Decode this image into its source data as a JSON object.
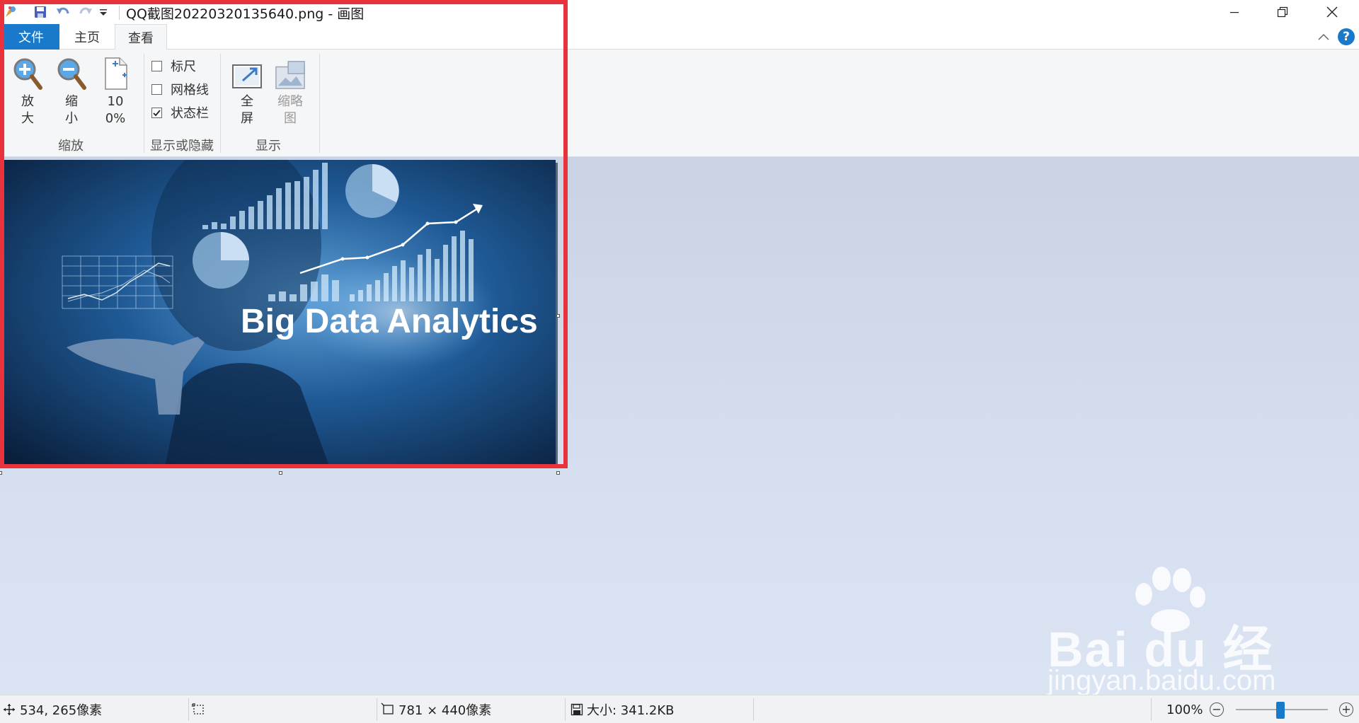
{
  "window": {
    "title": "QQ截图20220320135640.png - 画图"
  },
  "ribbon": {
    "tabs": [
      {
        "label": "文件"
      },
      {
        "label": "主页"
      },
      {
        "label": "查看"
      }
    ],
    "groups": {
      "zoom": {
        "label": "缩放",
        "zoom_in": "放大",
        "zoom_out": "缩小",
        "hundred": "100%"
      },
      "show_hide": {
        "label": "显示或隐藏",
        "ruler": {
          "label": "标尺",
          "checked": false
        },
        "gridlines": {
          "label": "网格线",
          "checked": false
        },
        "statusbar": {
          "label": "状态栏",
          "checked": true
        }
      },
      "display": {
        "label": "显示",
        "fullscreen": "全屏",
        "thumbnail": "缩略图"
      }
    }
  },
  "canvas": {
    "image_caption": "Big Data Analytics"
  },
  "statusbar": {
    "cursor_pos": "534, 265像素",
    "dimensions": "781 × 440像素",
    "size": "大小: 341.2KB",
    "zoom": "100%"
  },
  "watermark": {
    "brand": "Bai du 经验",
    "url": "jingyan.baidu.com"
  },
  "colors": {
    "accent": "#1979ca",
    "highlight_box": "#e8333d"
  }
}
